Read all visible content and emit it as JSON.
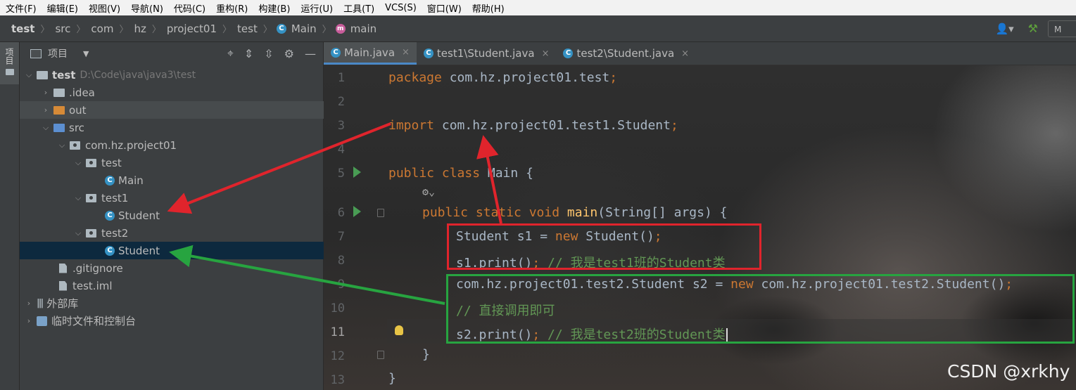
{
  "menu": [
    "文件(F)",
    "编辑(E)",
    "视图(V)",
    "导航(N)",
    "代码(C)",
    "重构(R)",
    "构建(B)",
    "运行(U)",
    "工具(T)",
    "VCS(S)",
    "窗口(W)",
    "帮助(H)"
  ],
  "breadcrumb": {
    "items": [
      "test",
      "src",
      "com",
      "hz",
      "project01",
      "test",
      "Main",
      "main"
    ],
    "class_badge": "C",
    "method_badge": "m"
  },
  "toolbar_right": {
    "user_icon": "user-icon",
    "build_icon": "hammer-icon",
    "run_config": "M"
  },
  "toolstrip": {
    "label": "项目"
  },
  "project": {
    "title": "项目",
    "tools": [
      "crosshair-icon",
      "expand-all-icon",
      "collapse-all-icon",
      "gear-icon",
      "minimize-icon"
    ],
    "tree": [
      {
        "label": "test",
        "path": "D:\\Code\\java\\java3\\test"
      },
      {
        "label": ".idea"
      },
      {
        "label": "out"
      },
      {
        "label": "src"
      },
      {
        "label": "com.hz.project01"
      },
      {
        "label": "test"
      },
      {
        "label": "Main"
      },
      {
        "label": "test1"
      },
      {
        "label": "Student"
      },
      {
        "label": "test2"
      },
      {
        "label": "Student"
      },
      {
        "label": ".gitignore"
      },
      {
        "label": "test.iml"
      },
      {
        "label": "外部库"
      },
      {
        "label": "临时文件和控制台"
      }
    ]
  },
  "tabs": [
    {
      "label": "Main.java",
      "close": "×"
    },
    {
      "label": "test1\\Student.java",
      "close": "×"
    },
    {
      "label": "test2\\Student.java",
      "close": "×"
    }
  ],
  "line_numbers": [
    "1",
    "2",
    "3",
    "4",
    "5",
    "6",
    "7",
    "8",
    "9",
    "10",
    "11",
    "12",
    "13"
  ],
  "code": {
    "l1_kw": "package",
    "l1_rest": " com.hz.project01.test",
    "l1_semi": ";",
    "l3_kw": "import",
    "l3_rest": " com.hz.project01.test1.Student",
    "l3_semi": ";",
    "l5_kw": "public class",
    "l5_rest": " Main {",
    "l6_kw": "public static void",
    "l6_fn": " main",
    "l6_rest": "(String[] args) {",
    "l7_a": "Student s1 = ",
    "l7_kw": "new",
    "l7_b": " Student()",
    "l7_semi": ";",
    "l8_a": "s1.print()",
    "l8_semi": ";",
    "l8_cm": " // 我是test1班的Student类",
    "l9_a": "com.hz.project01.test2.Student s2 = ",
    "l9_kw": "new",
    "l9_b": " com.hz.project01.test2.Student()",
    "l9_semi": ";",
    "l10_cm": "// 直接调用即可",
    "l11_a": "s2.print()",
    "l11_semi": ";",
    "l11_cm": " // 我是test2班的Student类",
    "l12": "}",
    "l13": "}"
  },
  "inlay_hint": "⚙⌄",
  "watermark": "CSDN @xrkhy",
  "colors": {
    "red_annotation": "#e0242c",
    "green_annotation": "#27a440",
    "keyword": "#cc7832",
    "comment": "#629755",
    "method": "#ffc66d"
  }
}
